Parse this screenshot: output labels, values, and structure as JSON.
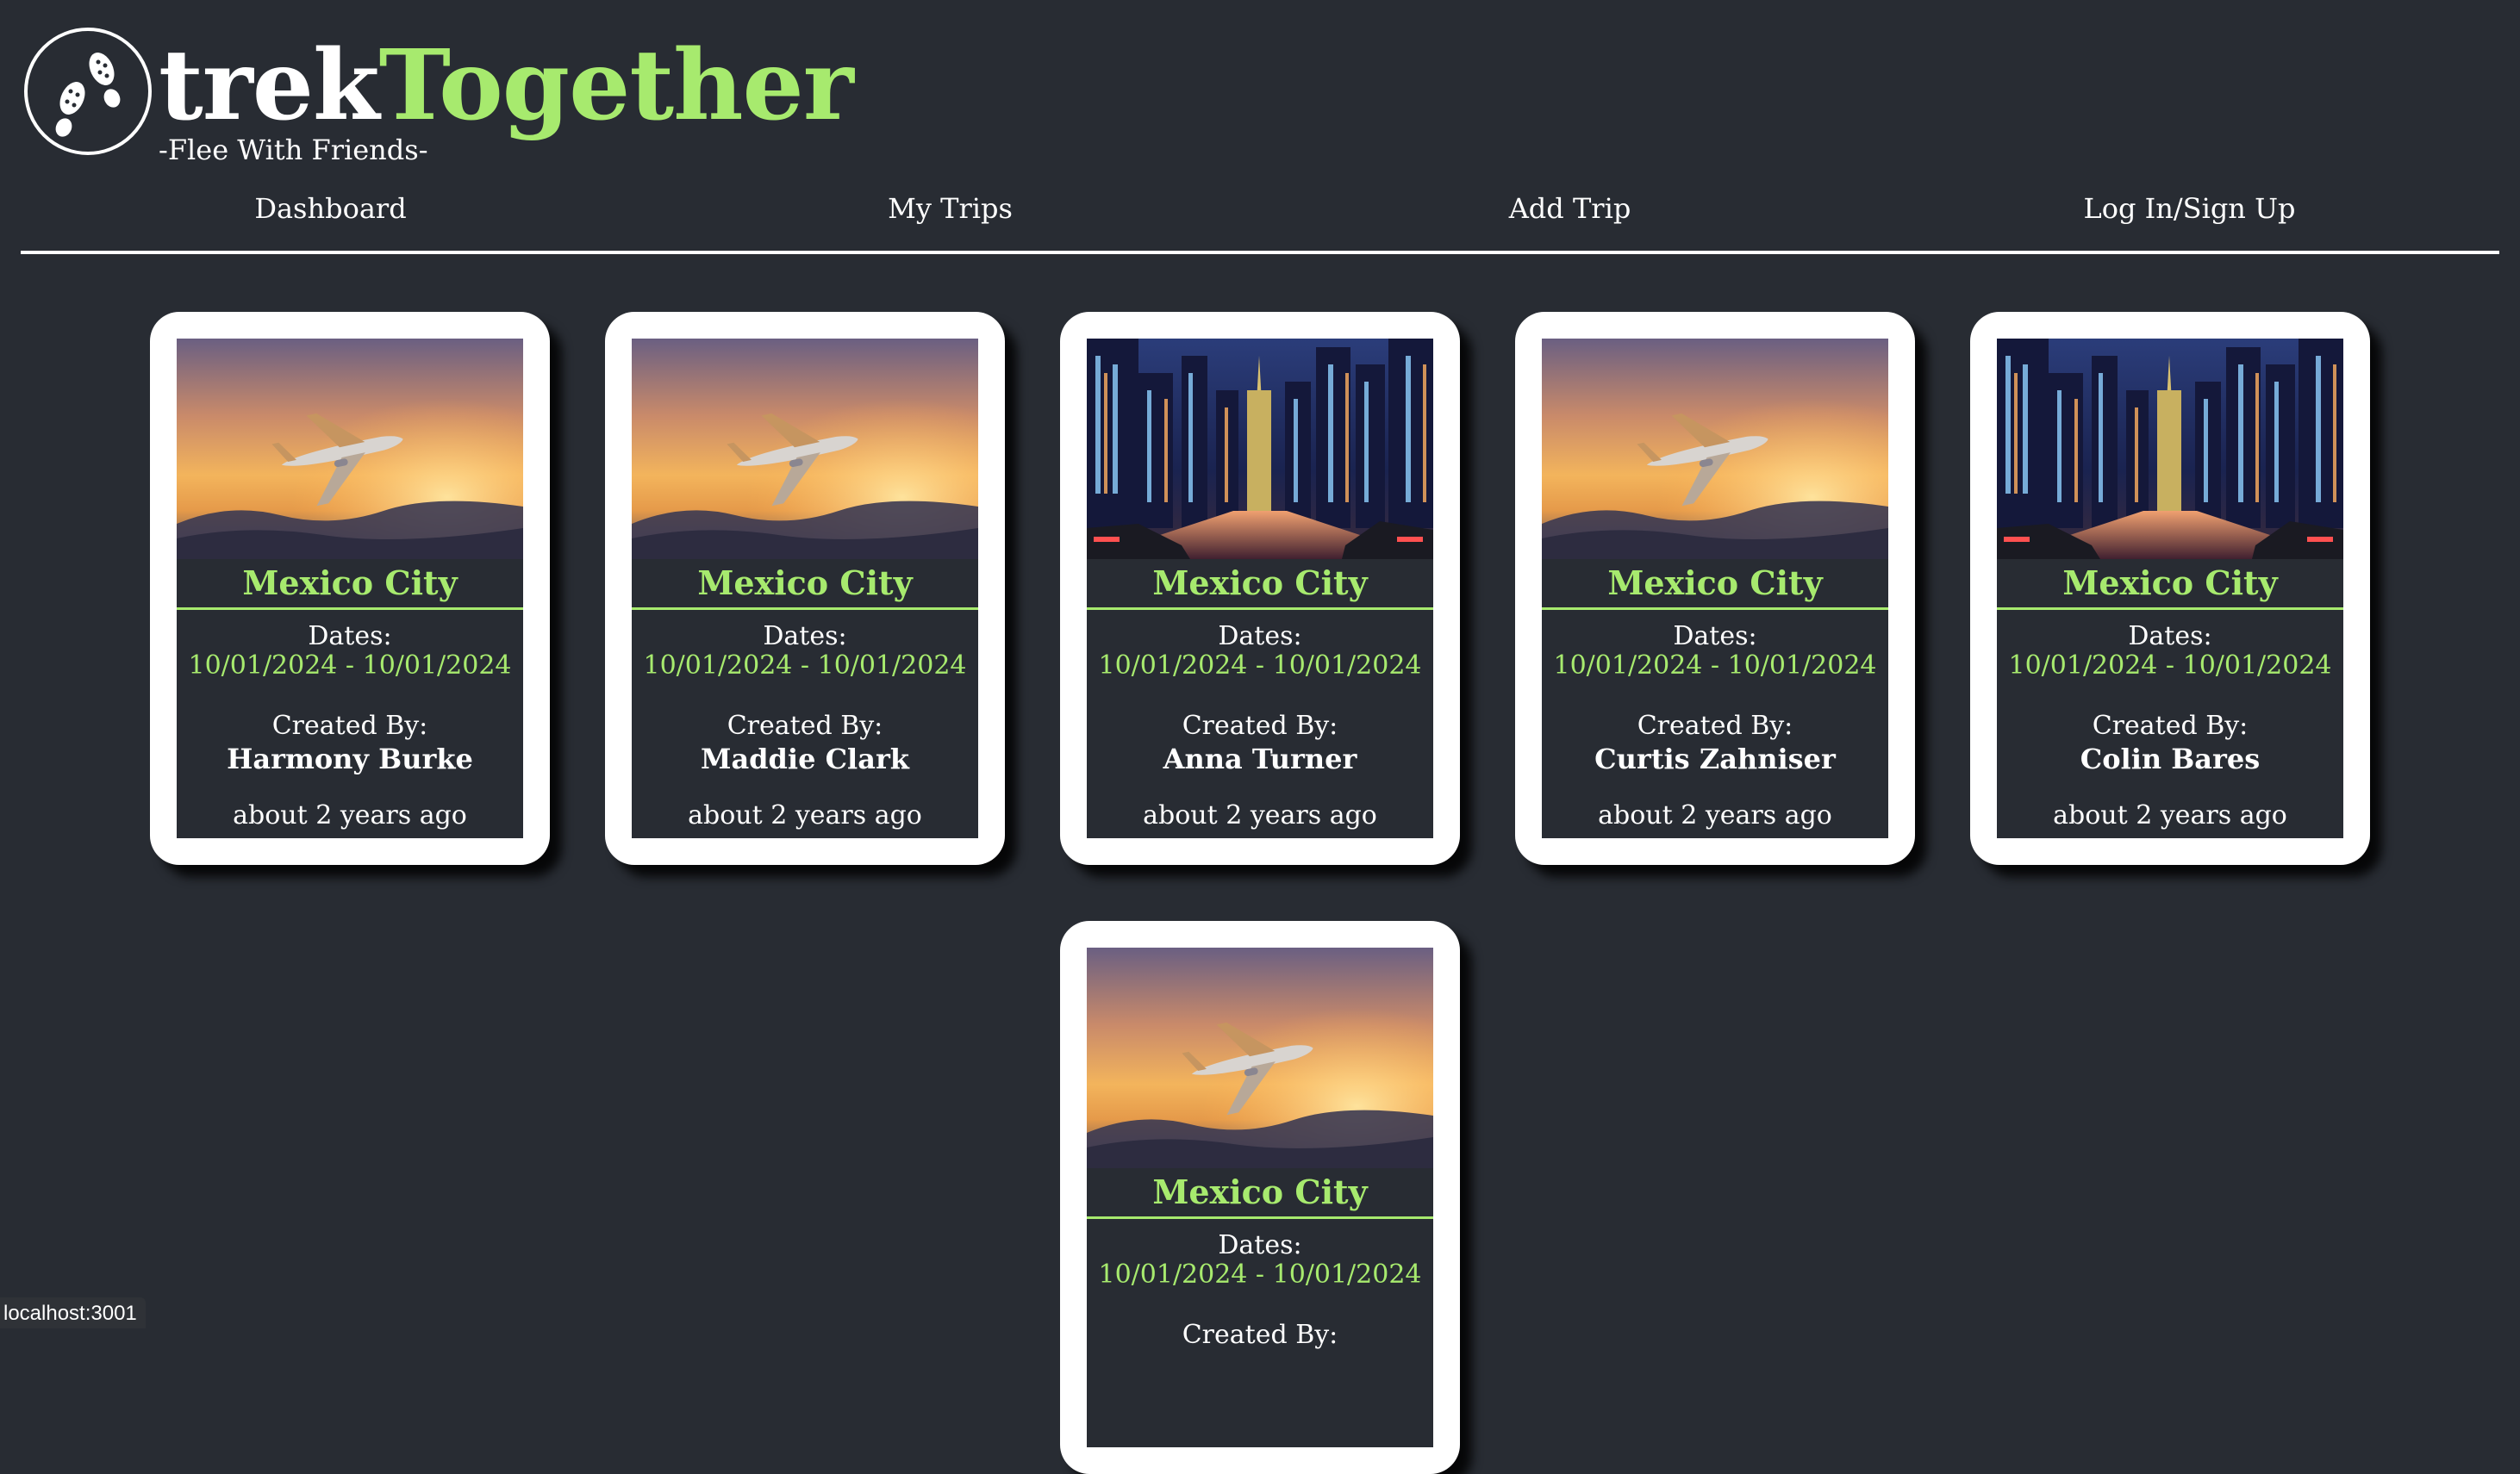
{
  "brand": {
    "part1": "trek",
    "part2": "Together",
    "tagline": "-Flee With Friends-",
    "logo_icon": "footprints-icon"
  },
  "nav": [
    {
      "label": "Dashboard"
    },
    {
      "label": "My Trips"
    },
    {
      "label": "Add Trip"
    },
    {
      "label": "Log In/Sign Up"
    }
  ],
  "cards": [
    {
      "image": "airplane-sunset",
      "city": "Mexico City",
      "dates_label": "Dates:",
      "dates": "10/01/2024 - 10/01/2024",
      "created_label": "Created By:",
      "creator": "Harmony Burke",
      "ago": "about 2 years ago"
    },
    {
      "image": "airplane-sunset",
      "city": "Mexico City",
      "dates_label": "Dates:",
      "dates": "10/01/2024 - 10/01/2024",
      "created_label": "Created By:",
      "creator": "Maddie Clark",
      "ago": "about 2 years ago"
    },
    {
      "image": "city-night",
      "city": "Mexico City",
      "dates_label": "Dates:",
      "dates": "10/01/2024 - 10/01/2024",
      "created_label": "Created By:",
      "creator": "Anna Turner",
      "ago": "about 2 years ago"
    },
    {
      "image": "airplane-sunset",
      "city": "Mexico City",
      "dates_label": "Dates:",
      "dates": "10/01/2024 - 10/01/2024",
      "created_label": "Created By:",
      "creator": "Curtis Zahniser",
      "ago": "about 2 years ago"
    },
    {
      "image": "city-night",
      "city": "Mexico City",
      "dates_label": "Dates:",
      "dates": "10/01/2024 - 10/01/2024",
      "created_label": "Created By:",
      "creator": "Colin Bares",
      "ago": "about 2 years ago"
    },
    {
      "image": "airplane-sunset",
      "city": "Mexico City",
      "dates_label": "Dates:",
      "dates": "10/01/2024 - 10/01/2024",
      "created_label": "Created By:",
      "creator": "",
      "ago": ""
    }
  ],
  "status_url": "localhost:3001",
  "colors": {
    "background": "#282c33",
    "accent": "#a7ea6e",
    "card": "#ffffff"
  }
}
